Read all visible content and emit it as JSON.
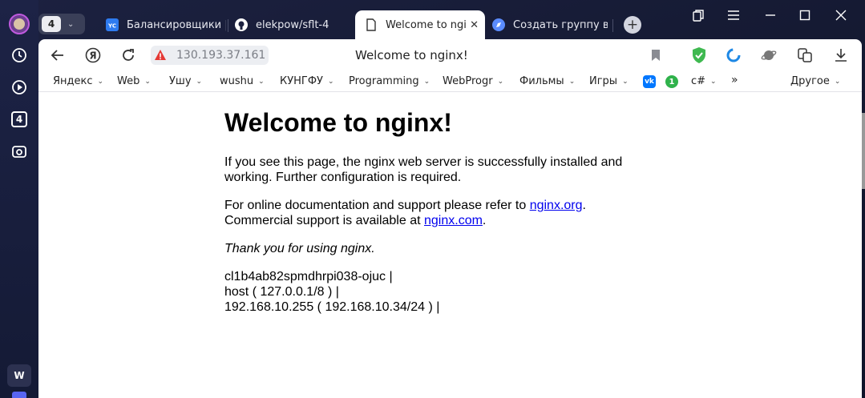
{
  "sidebar": {
    "counter": "4",
    "bottom_label": "W"
  },
  "tabbar": {
    "count": "4",
    "tabs": [
      {
        "label": "Балансировщики | Y",
        "favicon": "yc-icon"
      },
      {
        "label": "elekpow/sflt-4",
        "favicon": "github-icon"
      },
      {
        "label": "Welcome to nginx!",
        "favicon": "page-icon",
        "active": true
      },
      {
        "label": "Создать группу вир",
        "favicon": "compass-icon"
      }
    ]
  },
  "toolbar": {
    "url": "130.193.37.161",
    "title": "Welcome to nginx!"
  },
  "bookmarks": {
    "items": [
      "Яндекс",
      "Web",
      "Ушу",
      "wushu",
      "КУНГФУ",
      "Programming",
      "WebProgr",
      "Фильмы",
      "Игры",
      "c#"
    ],
    "vk": "vk",
    "one": "1",
    "more": "»",
    "other": "Другое"
  },
  "page": {
    "heading": "Welcome to nginx!",
    "p1": "If you see this page, the nginx web server is successfully installed and working. Further configuration is required.",
    "p2_a": "For online documentation and support please refer to ",
    "p2_link1": "nginx.org",
    "p2_b": ".",
    "p2_c": "Commercial support is available at ",
    "p2_link2": "nginx.com",
    "p2_d": ".",
    "p3": "Thank you for using nginx.",
    "p4_line1": "cl1b4ab82spmdhrpi038-ojuc |",
    "p4_line2": "host ( 127.0.0.1/8 ) |",
    "p4_line3": "192.168.10.255 ( 192.168.10.34/24 ) |"
  },
  "colors": {
    "link": "#0000ee",
    "sidebar_bg": "#1d2346",
    "shield": "#3fb950",
    "warning": "#e53935"
  }
}
